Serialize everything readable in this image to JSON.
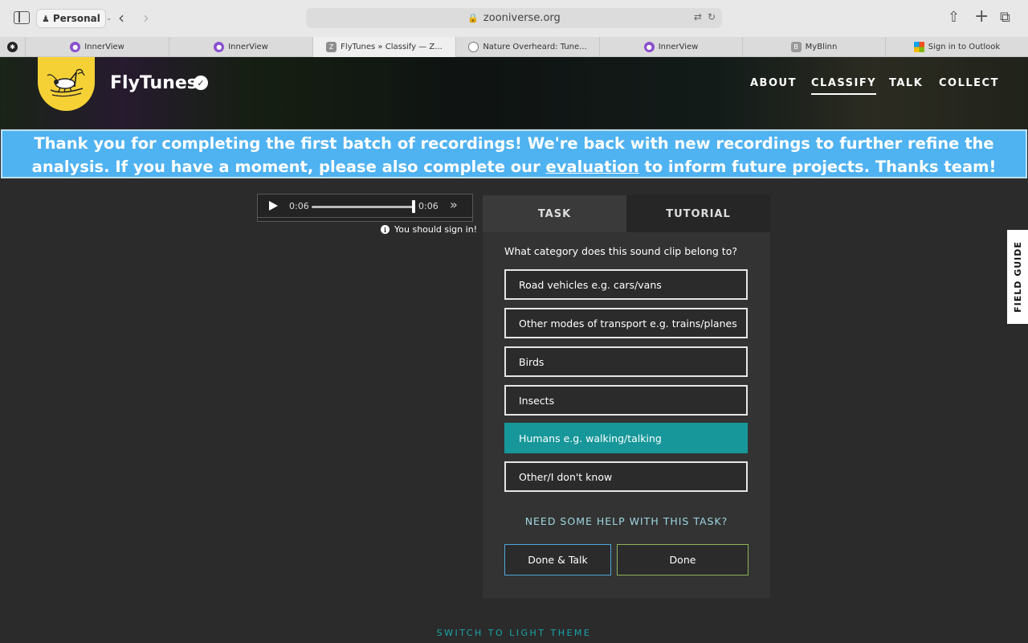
{
  "browser": {
    "profile": "Personal",
    "url": "zooniverse.org",
    "tabs": [
      {
        "title": "InnerView",
        "icon": "innerview-icon"
      },
      {
        "title": "InnerView",
        "icon": "innerview-icon"
      },
      {
        "title": "FlyTunes » Classify — Z...",
        "icon": "zooniverse-icon",
        "active": true
      },
      {
        "title": "Nature Overheard: Tune...",
        "icon": "globe-icon"
      },
      {
        "title": "InnerView",
        "icon": "innerview-icon"
      },
      {
        "title": "MyBlinn",
        "icon": "blinn-icon"
      },
      {
        "title": "Sign in to Outlook",
        "icon": "microsoft-icon"
      }
    ]
  },
  "header": {
    "title": "FlyTunes",
    "nav": [
      "ABOUT",
      "CLASSIFY",
      "TALK",
      "COLLECT"
    ],
    "active_nav": "CLASSIFY"
  },
  "announcement": {
    "text_before": "Thank you for completing the first batch of recordings! We're back with new recordings to further refine the analysis. If you have a moment, please also complete our ",
    "link": "evaluation",
    "text_after": " to inform future projects. Thanks team!"
  },
  "player": {
    "current_time": "0:06",
    "duration": "0:06",
    "progress": 1.0,
    "signin_notice": "You should sign in!"
  },
  "task": {
    "tabs": [
      "TASK",
      "TUTORIAL"
    ],
    "question": "What category does this sound clip belong to?",
    "answers": [
      "Road vehicles e.g. cars/vans",
      "Other modes of transport e.g. trains/planes",
      "Birds",
      "Insects",
      "Humans e.g. walking/talking",
      "Other/I don't know"
    ],
    "selected_answer": "Humans e.g. walking/talking",
    "help": "NEED SOME HELP WITH THIS TASK?",
    "done_talk": "Done & Talk",
    "done": "Done"
  },
  "field_guide": "FIELD GUIDE",
  "theme_switch": "SWITCH TO LIGHT THEME",
  "colors": {
    "announcement_bg": "#4fb2f1",
    "selected_answer": "#17979a",
    "logo_yellow": "#f6d136",
    "theme_link": "#1aa5a8"
  }
}
